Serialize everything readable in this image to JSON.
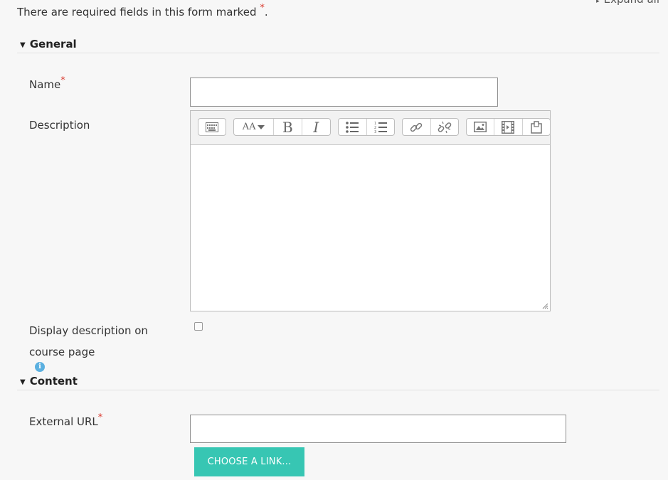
{
  "form": {
    "required_note": "There are required fields in this form marked",
    "required_marker": "*",
    "required_note_end": ".",
    "expand_all": "Expand all"
  },
  "general": {
    "header": "General",
    "name_label": "Name",
    "description_label": "Description",
    "display_description_label_line1": "Display description on",
    "display_description_label_line2": "course page",
    "display_description_checked": false,
    "name_value": ""
  },
  "editor": {
    "toolbar_icons": [
      "show-more-buttons-icon",
      "font-style-icon",
      "bold-icon",
      "italic-icon",
      "unordered-list-icon",
      "ordered-list-icon",
      "link-icon",
      "unlink-icon",
      "image-icon",
      "media-icon",
      "manage-files-icon"
    ],
    "bold_glyph": "B",
    "italic_glyph": "I",
    "font_glyph": "AA",
    "content": ""
  },
  "content": {
    "header": "Content",
    "external_url_label": "External URL",
    "external_url_value": "",
    "choose_link_button": "CHOOSE A LINK..."
  },
  "colors": {
    "accent": "#37c6b3",
    "required": "#d9382c",
    "info": "#5bb0e0"
  }
}
